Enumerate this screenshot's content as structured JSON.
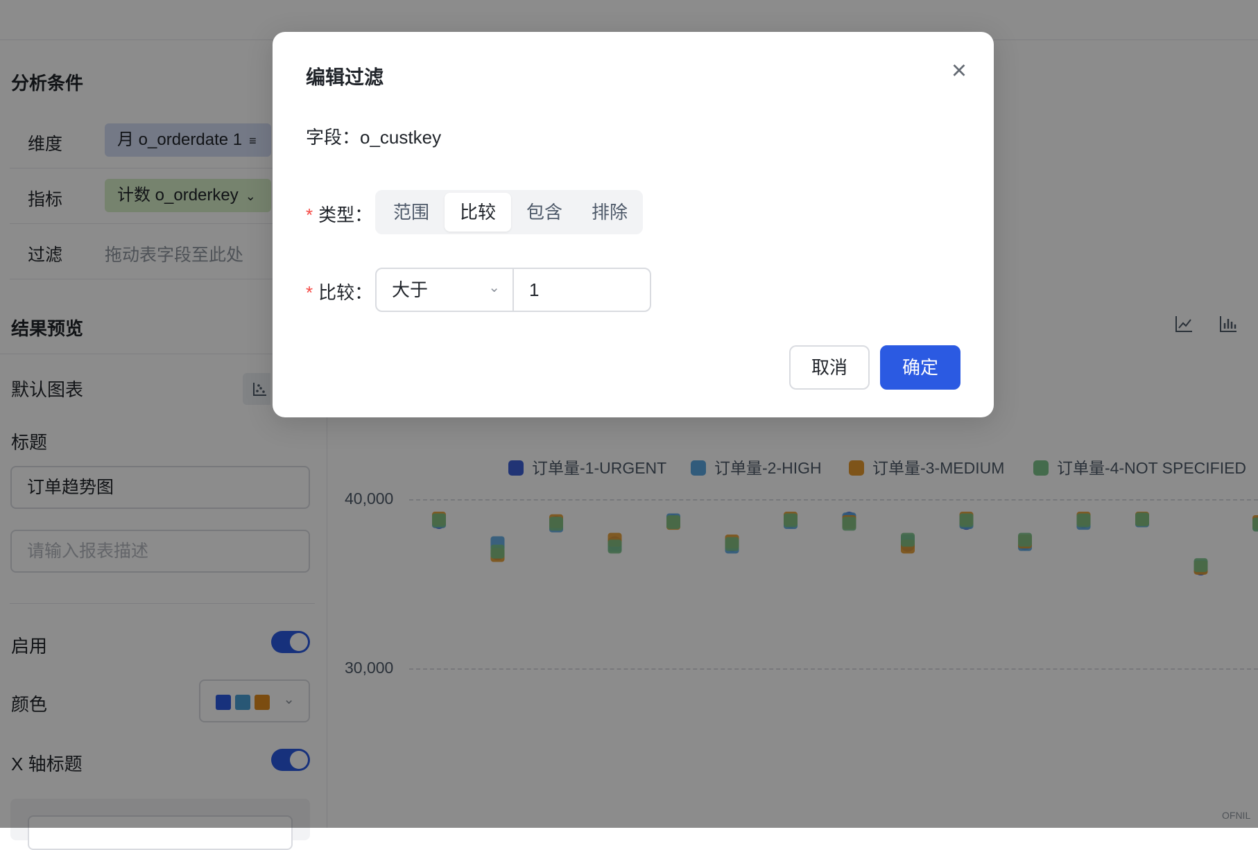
{
  "left_panel": {
    "analysis_title": "分析条件",
    "dimension_label": "维度",
    "dimension_pill": "月 o_orderdate 1",
    "metric_label": "指标",
    "metric_pill": "计数 o_orderkey",
    "filter_label": "过滤",
    "filter_hint": "拖动表字段至此处",
    "preview_title": "结果预览",
    "default_chart_label": "默认图表",
    "title_label": "标题",
    "title_value": "订单趋势图",
    "desc_placeholder": "请输入报表描述",
    "enable_label": "启用",
    "enable_on": true,
    "color_label": "颜色",
    "color_swatches": [
      "#2b5ae2",
      "#4a9ed6",
      "#e08a1e"
    ],
    "x_axis_title_label": "X 轴标题",
    "x_axis_title_on": true
  },
  "chart_data": {
    "type": "scatter",
    "title": "",
    "xlabel": "",
    "ylabel": "",
    "ylim": [
      25000,
      42000
    ],
    "yticks": [
      "40,000",
      "30,000"
    ],
    "ytick_values": [
      40000,
      30000
    ],
    "colors": [
      "#3d5fd6",
      "#5aa6e0",
      "#e59a2e",
      "#7cc38a"
    ],
    "series": [
      {
        "name": "订单量-1-URGENT",
        "values": [
          38650,
          36800,
          38600,
          37400,
          38700,
          37300,
          38700,
          38850,
          37300,
          38600,
          37400,
          38700,
          38800,
          35900,
          38600
        ]
      },
      {
        "name": "订单量-2-HIGH",
        "values": [
          38700,
          37400,
          38450,
          37300,
          38750,
          37200,
          38650,
          38800,
          37500,
          38650,
          37350,
          38600,
          38750,
          36000,
          38550
        ]
      },
      {
        "name": "订单量-3-MEDIUM",
        "values": [
          38850,
          36700,
          38700,
          37600,
          38600,
          37500,
          38850,
          38650,
          37200,
          38850,
          37500,
          38850,
          38850,
          35950,
          38650
        ]
      },
      {
        "name": "订单量-4-NOT SPECIFIED",
        "values": [
          38750,
          36900,
          38550,
          37200,
          38650,
          37350,
          38750,
          38550,
          37600,
          38750,
          37600,
          38750,
          38800,
          36100,
          38500
        ]
      }
    ],
    "watermark": "OFNIL"
  },
  "modal": {
    "title": "编辑过滤",
    "field_line": "字段：o_custkey",
    "type_label": "类型：",
    "type_options": [
      "范围",
      "比较",
      "包含",
      "排除"
    ],
    "type_selected": "比较",
    "compare_label": "比较：",
    "compare_operator": "大于",
    "compare_value": "1",
    "cancel": "取消",
    "ok": "确定"
  }
}
